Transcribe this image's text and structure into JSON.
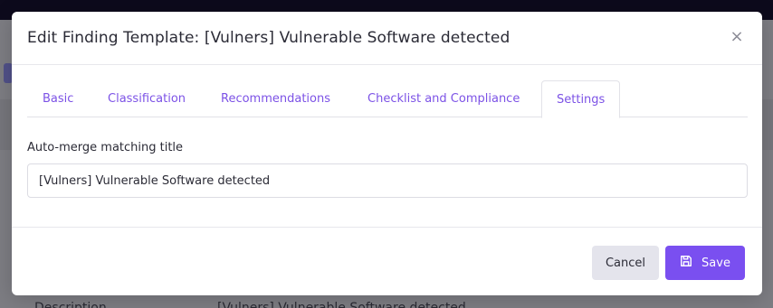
{
  "backdrop": {
    "row_label": "Description",
    "row_value": "[Vulners] Vulnerable Software detected"
  },
  "modal": {
    "title": "Edit Finding Template: [Vulners] Vulnerable Software detected",
    "close_glyph": "×",
    "tabs": [
      {
        "label": "Basic",
        "active": false
      },
      {
        "label": "Classification",
        "active": false
      },
      {
        "label": "Recommendations",
        "active": false
      },
      {
        "label": "Checklist and Compliance",
        "active": false
      },
      {
        "label": "Settings",
        "active": true
      }
    ],
    "field": {
      "label": "Auto-merge matching title",
      "value": "[Vulners] Vulnerable Software detected"
    },
    "footer": {
      "cancel_label": "Cancel",
      "save_label": "Save"
    }
  },
  "icons": {
    "close": "close-icon",
    "save": "floppy-disk-icon"
  },
  "colors": {
    "accent": "#7a4ff0",
    "tab_text": "#7c52e6",
    "cancel_bg": "#e4e4ec"
  }
}
